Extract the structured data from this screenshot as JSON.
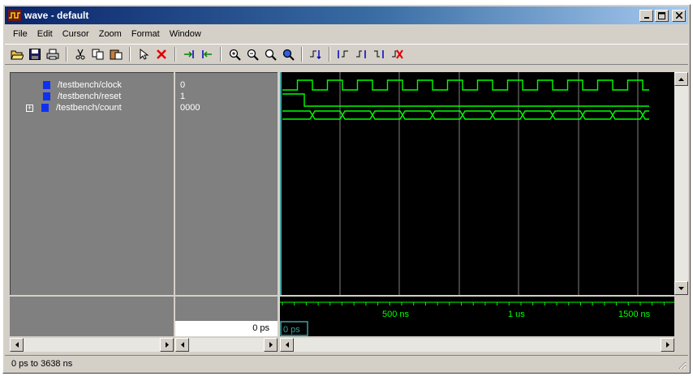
{
  "window": {
    "title": "wave - default"
  },
  "menu": [
    "File",
    "Edit",
    "Cursor",
    "Zoom",
    "Format",
    "Window"
  ],
  "toolbar": {
    "groups": [
      [
        "open-folder-icon",
        "save-icon",
        "print-icon"
      ],
      [
        "cut-icon",
        "copy-icon",
        "paste-icon"
      ],
      [
        "select-pointer-icon",
        "delete-icon"
      ],
      [
        "insert-cursor-icon",
        "remove-cursor-icon"
      ],
      [
        "zoom-in-icon",
        "zoom-out-icon",
        "zoom-full-icon",
        "zoom-area-icon"
      ],
      [
        "find-edge-icon"
      ],
      [
        "previous-edge-icon",
        "next-edge-icon",
        "next-falling-edge-icon",
        "clear-edges-icon"
      ]
    ]
  },
  "signals": [
    {
      "name": "/testbench/clock",
      "value": "0",
      "expandable": false
    },
    {
      "name": "/testbench/reset",
      "value": "1",
      "expandable": false
    },
    {
      "name": "/testbench/count",
      "value": "0000",
      "expandable": true
    }
  ],
  "cursor": {
    "time": "0 ps",
    "wave_label": "0 ps"
  },
  "timeline": {
    "labels": [
      "500 ns",
      "1 us",
      "1500 ns"
    ]
  },
  "status": {
    "range": "0 ps to 3638 ns"
  },
  "colors": {
    "wave": "#00ff00",
    "cursor": "#40a0a0",
    "grid": "#808080",
    "swatch": "#1030f0"
  }
}
